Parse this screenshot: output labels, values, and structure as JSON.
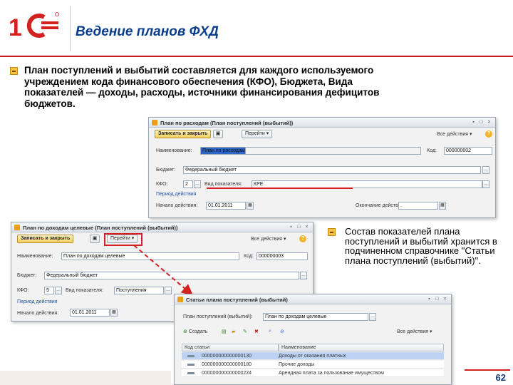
{
  "slide": {
    "title": "Ведение планов ФХД",
    "main_text": "План поступлений и выбытий составляется для каждого используемого учреждением кода финансового обеспечения (КФО), Бюджета, Вида показателей — доходы, расходы, источники финансирования дефицитов бюджетов.",
    "side_text": "Состав показателей плана поступлений и выбытий хранится в подчиненном справочнике \"Статьи плана поступлений (выбытий)\".",
    "page_number": "62",
    "accent_color": "#c61b1b",
    "title_color": "#0a3d8a"
  },
  "form_expenses": {
    "title": "План по расходам (План поступлений (выбытий))",
    "save_close": "Записать и закрыть",
    "goto": "Перейти",
    "all_actions": "Все действия",
    "name_label": "Наименование:",
    "name_value": "План по расходам",
    "code_label": "Код:",
    "code_value": "000000002",
    "budget_label": "Бюджет:",
    "budget_value": "Федеральный бюджет",
    "kfo_label": "КФО:",
    "kfo_value": "2",
    "indicator_label": "Вид показателя:",
    "indicator_value": "КРЕ",
    "duration_label": "Период действия",
    "start_label": "Начало действия:",
    "start_value": "01.01.2011",
    "end_label": "Окончание действия:",
    "end_value": "."
  },
  "form_income": {
    "title": "План по доходам целевые (План поступлений (выбытий))",
    "save_close": "Записать и закрыть",
    "goto": "Перейти",
    "all_actions": "Все действия",
    "name_label": "Наименование:",
    "name_value": "План по доходам целевые",
    "code_label": "Код:",
    "code_value": "000000003",
    "budget_label": "Бюджет:",
    "budget_value": "Федеральный бюджет",
    "kfo_label": "КФО:",
    "kfo_value": "5",
    "indicator_label": "Вид показателя:",
    "indicator_value": "Поступления",
    "duration_label": "Период действия",
    "start_label": "Начало действия:",
    "start_value": "01.01.2011"
  },
  "form_articles": {
    "title": "Статьи плана поступлений (выбытий)",
    "plan_label": "План поступлений (выбытий):",
    "plan_value": "План по доходам целевые",
    "create": "Создать",
    "all_actions": "Все действия",
    "columns": [
      "Код статьи",
      "Наименование"
    ],
    "rows": [
      {
        "code": "000000000000000130",
        "name": "Доходы от оказания платных",
        "selected": true
      },
      {
        "code": "000000000000000180",
        "name": "Прочие доходы",
        "selected": false
      },
      {
        "code": "000000000000000224",
        "name": "Арендная плата за пользование имуществом",
        "selected": false
      }
    ]
  }
}
